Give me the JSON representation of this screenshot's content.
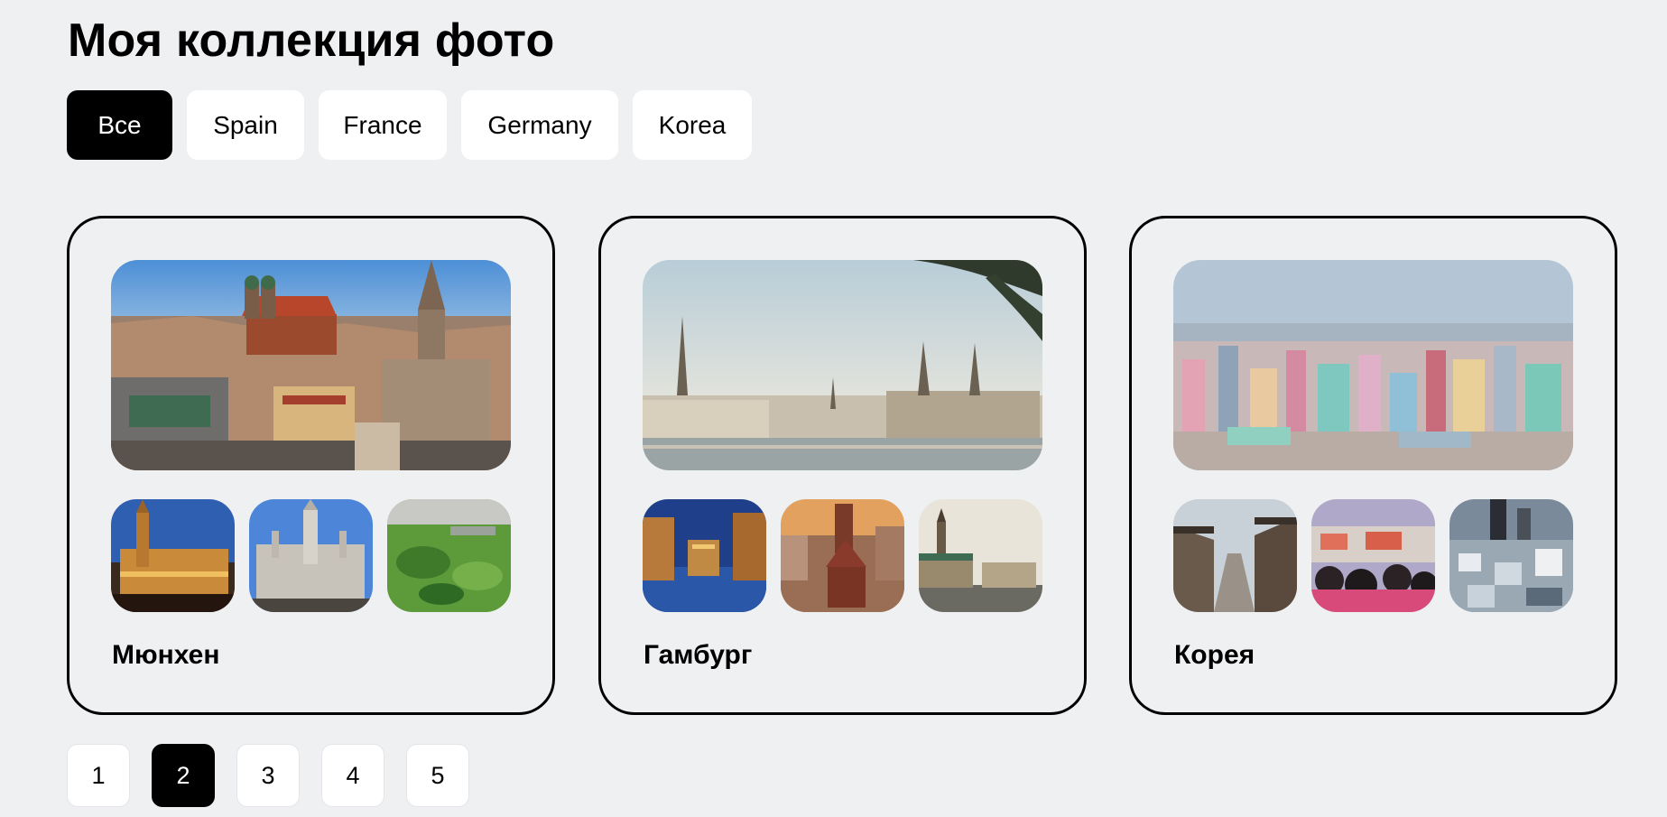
{
  "page": {
    "title": "Моя коллекция фото",
    "background": "#eff0f2"
  },
  "filters": {
    "active": "Все",
    "items": [
      "Все",
      "Spain",
      "France",
      "Germany",
      "Korea"
    ]
  },
  "collections": [
    {
      "title": "Мюнхен",
      "hero": "munich-cityscape-photo",
      "thumbnails": [
        "munich-town-hall-night-photo",
        "munich-town-hall-day-photo",
        "munich-park-aerial-photo"
      ]
    },
    {
      "title": "Гамбург",
      "hero": "hamburg-lake-skyline-photo",
      "thumbnails": [
        "hamburg-speicherstadt-photo",
        "hamburg-old-town-photo",
        "hamburg-town-hall-photo"
      ]
    },
    {
      "title": "Корея",
      "hero": "korea-city-skyline-photo",
      "thumbnails": [
        "korea-hanok-village-photo",
        "korea-crowd-photo",
        "korea-city-aerial-photo"
      ]
    }
  ],
  "pagination": {
    "current": "2",
    "pages": [
      "1",
      "2",
      "3",
      "4",
      "5"
    ]
  },
  "colors": {
    "accent": "#000000",
    "surface": "#ffffff",
    "card_border": "#000000"
  }
}
